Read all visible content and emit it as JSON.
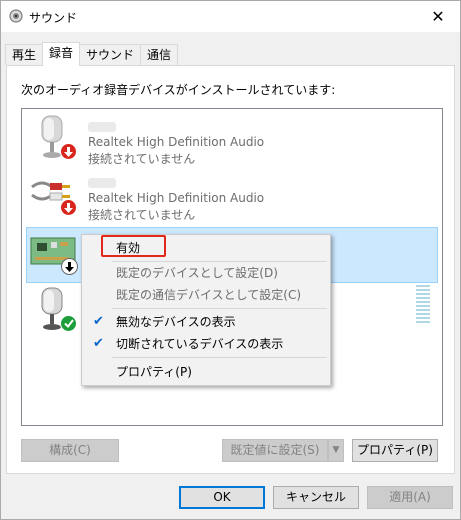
{
  "window": {
    "title": "サウンド",
    "close_glyph": "✕"
  },
  "tabs": [
    {
      "label": "再生",
      "active": false
    },
    {
      "label": "録音",
      "active": true
    },
    {
      "label": "サウンド",
      "active": false
    },
    {
      "label": "通信",
      "active": false
    }
  ],
  "panel": {
    "description": "次のオーディオ録音デバイスがインストールされています:"
  },
  "devices": [
    {
      "icon": "microphone-icon",
      "name": "Realtek High Definition Audio",
      "status": "接続されていません",
      "badge": "down-arrow-red"
    },
    {
      "icon": "line-in-cable-icon",
      "name": "Realtek High Definition Audio",
      "status": "接続されていません",
      "badge": "down-arrow-red"
    },
    {
      "icon": "circuit-board-icon",
      "name": "",
      "status": "",
      "badge": "down-arrow-black",
      "selected": true
    },
    {
      "icon": "microphone-icon",
      "name": "",
      "status": "",
      "badge": "check-green"
    }
  ],
  "context_menu": {
    "items": [
      {
        "label": "有効",
        "enabled": true,
        "checked": false,
        "highlighted": true
      },
      {
        "label": "既定のデバイスとして設定(D)",
        "enabled": false,
        "checked": false
      },
      {
        "label": "既定の通信デバイスとして設定(C)",
        "enabled": false,
        "checked": false
      },
      {
        "label": "無効なデバイスの表示",
        "enabled": true,
        "checked": true
      },
      {
        "label": "切断されているデバイスの表示",
        "enabled": true,
        "checked": true
      },
      {
        "label": "プロパティ(P)",
        "enabled": true,
        "checked": false
      }
    ]
  },
  "buttons": {
    "configure": "構成(C)",
    "set_default": "既定値に設定(S)",
    "properties": "プロパティ(P)",
    "ok": "OK",
    "cancel": "キャンセル",
    "apply": "適用(A)"
  },
  "colors": {
    "selection": "#cce8ff",
    "highlight_box": "#e2271b",
    "badge_red": "#d9261c",
    "badge_green": "#1e9e3a"
  }
}
